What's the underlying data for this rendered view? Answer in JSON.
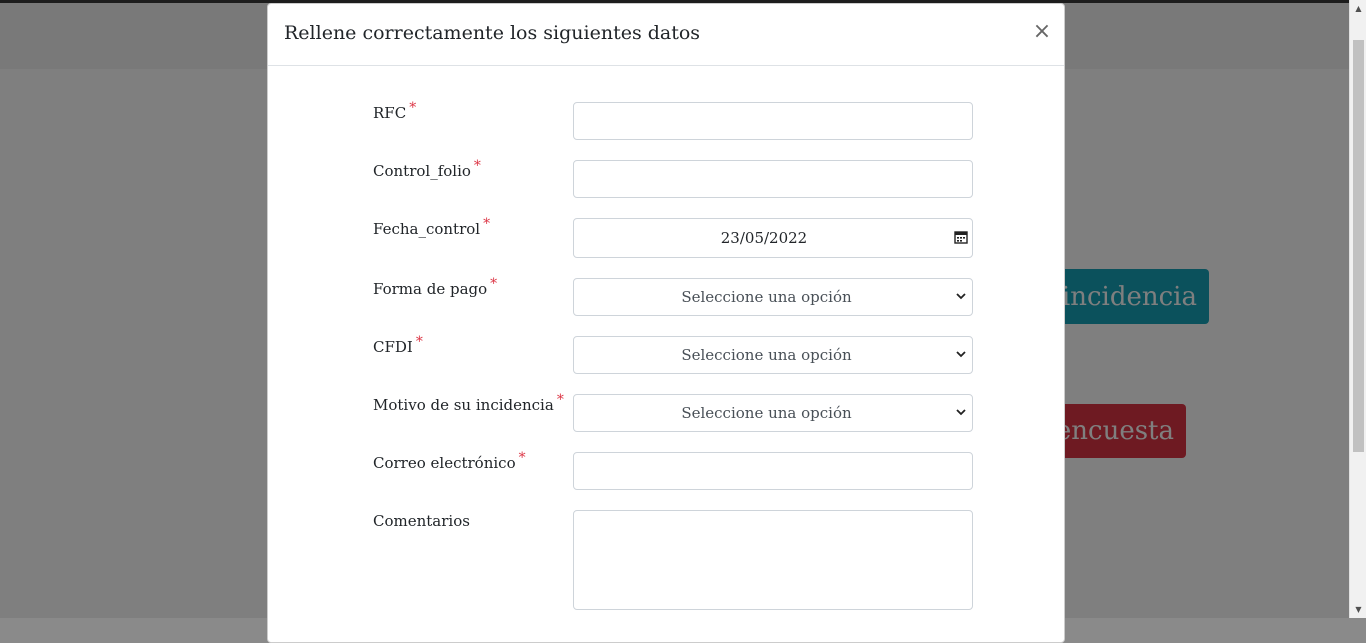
{
  "background": {
    "teal_button_label": "r incidencia",
    "red_button_label": "encuesta"
  },
  "modal": {
    "title": "Rellene correctamente los siguientes datos",
    "close_label": "×"
  },
  "form": {
    "required_mark": "*",
    "rfc": {
      "label": "RFC",
      "value": ""
    },
    "control_folio": {
      "label": "Control_folio",
      "value": ""
    },
    "fecha_control": {
      "label": "Fecha_control",
      "value": "23/05/2022"
    },
    "forma_pago": {
      "label": "Forma de pago",
      "selected": "Seleccione una opción"
    },
    "cfdi": {
      "label": "CFDI",
      "selected": "Seleccione una opción"
    },
    "motivo": {
      "label": "Motivo de su incidencia",
      "selected": "Seleccione una opción"
    },
    "correo": {
      "label": "Correo electrónico",
      "value": ""
    },
    "comentarios": {
      "label": "Comentarios",
      "value": ""
    }
  },
  "colors": {
    "required": "#dc3545",
    "teal_button": "#17a2b8",
    "red_button": "#dc3545"
  },
  "icons": {
    "close": "close-icon",
    "calendar": "calendar-icon",
    "select": "chevron-down-icon"
  }
}
